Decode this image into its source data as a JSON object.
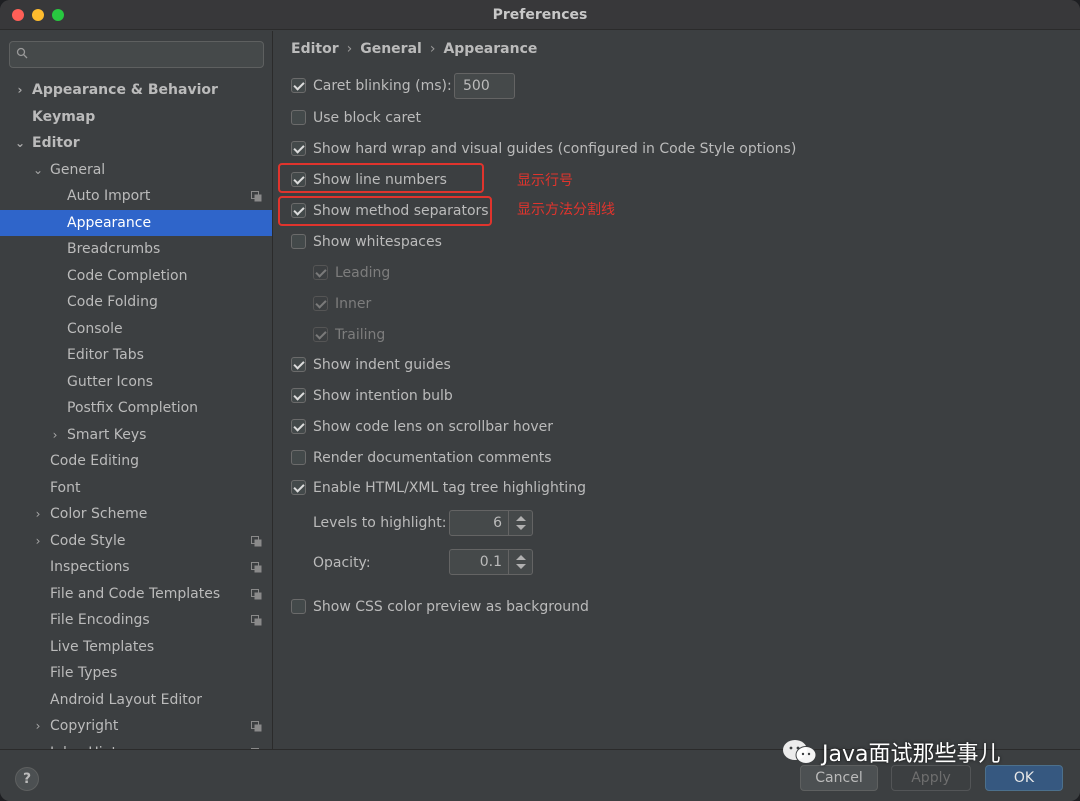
{
  "window": {
    "title": "Preferences"
  },
  "search": {
    "placeholder": ""
  },
  "sidebar": {
    "items": [
      {
        "label": "Appearance & Behavior",
        "arrow": "›"
      },
      {
        "label": "Keymap"
      },
      {
        "label": "Editor",
        "arrow": "⌄"
      },
      {
        "label": "General",
        "arrow": "⌄"
      },
      {
        "label": "Auto Import"
      },
      {
        "label": "Appearance"
      },
      {
        "label": "Breadcrumbs"
      },
      {
        "label": "Code Completion"
      },
      {
        "label": "Code Folding"
      },
      {
        "label": "Console"
      },
      {
        "label": "Editor Tabs"
      },
      {
        "label": "Gutter Icons"
      },
      {
        "label": "Postfix Completion"
      },
      {
        "label": "Smart Keys",
        "arrow": "›"
      },
      {
        "label": "Code Editing"
      },
      {
        "label": "Font"
      },
      {
        "label": "Color Scheme",
        "arrow": "›"
      },
      {
        "label": "Code Style",
        "arrow": "›"
      },
      {
        "label": "Inspections"
      },
      {
        "label": "File and Code Templates"
      },
      {
        "label": "File Encodings"
      },
      {
        "label": "Live Templates"
      },
      {
        "label": "File Types"
      },
      {
        "label": "Android Layout Editor"
      },
      {
        "label": "Copyright",
        "arrow": "›"
      },
      {
        "label": "Inlay Hints",
        "arrow": "›"
      }
    ]
  },
  "breadcrumb": {
    "part1": "Editor",
    "part2": "General",
    "part3": "Appearance",
    "sep": "›"
  },
  "options": {
    "caret_blinking": "Caret blinking (ms):",
    "caret_blinking_value": "500",
    "block_caret": "Use block caret",
    "hard_wrap": "Show hard wrap and visual guides (configured in Code Style options)",
    "line_numbers": "Show line numbers",
    "method_separators": "Show method separators",
    "whitespaces": "Show whitespaces",
    "leading": "Leading",
    "inner": "Inner",
    "trailing": "Trailing",
    "indent_guides": "Show indent guides",
    "intention_bulb": "Show intention bulb",
    "code_lens": "Show code lens on scrollbar hover",
    "render_docs": "Render documentation comments",
    "tag_tree": "Enable HTML/XML tag tree highlighting",
    "levels_label": "Levels to highlight:",
    "levels_value": "6",
    "opacity_label": "Opacity:",
    "opacity_value": "0.1",
    "css_preview": "Show CSS color preview as background"
  },
  "annotations": {
    "line_numbers": "显示行号",
    "method_separators": "显示方法分割线"
  },
  "buttons": {
    "help": "?",
    "cancel": "Cancel",
    "apply": "Apply",
    "ok": "OK"
  },
  "watermark": {
    "text": "Java面试那些事儿"
  },
  "colors": {
    "selection": "#2f65ca",
    "annotation": "#e0342d",
    "ok_button": "#365880"
  }
}
